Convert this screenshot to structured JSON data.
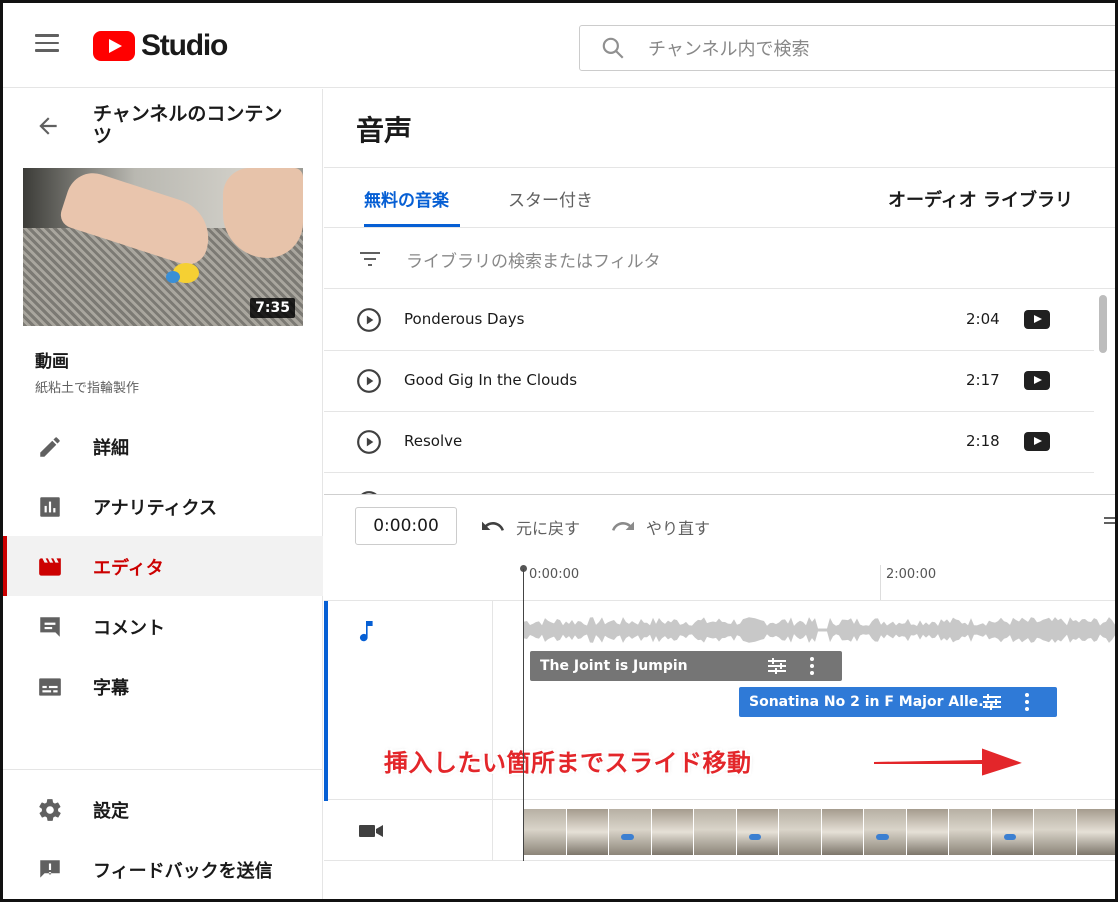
{
  "header": {
    "logo_text": "Studio",
    "search_placeholder": "チャンネル内で検索"
  },
  "sidebar": {
    "back_title": "チャンネルのコンテンツ",
    "video_duration": "7:35",
    "video_label": "動画",
    "video_title": "紙粘土で指輪製作",
    "nav": [
      {
        "label": "詳細",
        "icon": "pencil-icon"
      },
      {
        "label": "アナリティクス",
        "icon": "analytics-icon"
      },
      {
        "label": "エディタ",
        "icon": "clapperboard-icon",
        "active": true
      },
      {
        "label": "コメント",
        "icon": "comment-icon"
      },
      {
        "label": "字幕",
        "icon": "subtitles-icon"
      }
    ],
    "bottom_nav": [
      {
        "label": "設定",
        "icon": "gear-icon"
      },
      {
        "label": "フィードバックを送信",
        "icon": "feedback-icon"
      }
    ]
  },
  "main": {
    "title": "音声",
    "tabs": [
      {
        "label": "無料の音楽",
        "active": true
      },
      {
        "label": "スター付き",
        "active": false
      }
    ],
    "library_title": "オーディオ ライブラリ",
    "filter_placeholder": "ライブラリの検索またはフィルタ",
    "tracks": [
      {
        "name": "Ponderous Days",
        "duration": "2:04"
      },
      {
        "name": "Good Gig In the Clouds",
        "duration": "2:17"
      },
      {
        "name": "Resolve",
        "duration": "2:18"
      }
    ]
  },
  "editor": {
    "timecode": "0:00:00",
    "undo_label": "元に戻す",
    "redo_label": "やり直す",
    "ruler": [
      "0:00:00",
      "2:00:00"
    ],
    "clip1": "The Joint is Jumpin",
    "clip2": "Sonatina No 2 in F Major Alle...",
    "annotation": "挿入したい箇所までスライド移動"
  },
  "colors": {
    "brand_red": "#ff0000",
    "active_red": "#cc0000",
    "accent_blue": "#065fd4",
    "clip_blue": "#2f7ad7",
    "annotation_red": "#e3262a"
  }
}
